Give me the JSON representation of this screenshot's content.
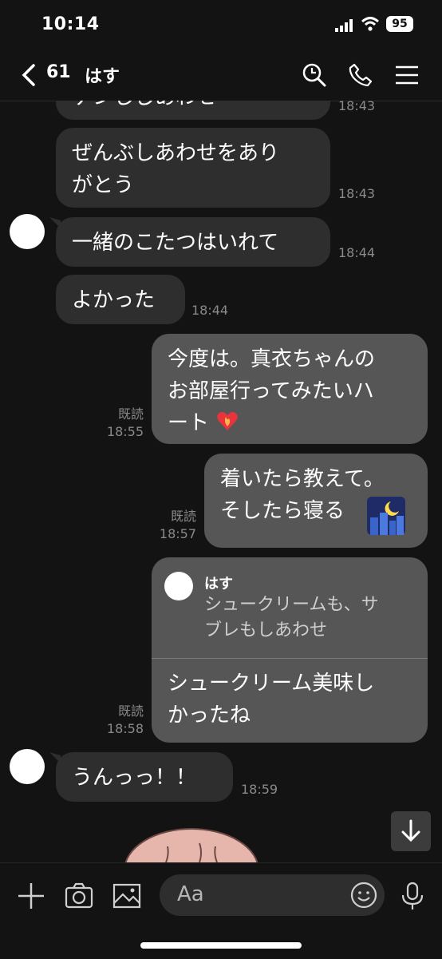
{
  "status": {
    "time": "10:14",
    "battery": "95"
  },
  "header": {
    "unread_count": "61",
    "contact_name": "はす"
  },
  "messages": [
    {
      "text": "ゲンしじあわせ",
      "time": "18:43"
    },
    {
      "text": "ぜんぶしあわせをあり\nがとう",
      "time": "18:43"
    },
    {
      "text": "一緒のこたつはいれて",
      "time": "18:44"
    },
    {
      "text": "よかった",
      "time": "18:44"
    },
    {
      "text": "今度は。真衣ちゃんの\nお部屋行ってみたいハ\nート",
      "read": "既読",
      "time": "18:55"
    },
    {
      "text": "着いたら教えて。\nそしたら寝る",
      "read": "既読",
      "time": "18:57"
    },
    {
      "reply_name": "はす",
      "reply_text": "シュークリームも、サ\nブレもしあわせ",
      "text": "シュークリーム美味し\nかったね",
      "read": "既読",
      "time": "18:58"
    },
    {
      "text": "うんっっ！！",
      "time": "18:59"
    }
  ],
  "input": {
    "placeholder": "Aa"
  },
  "icons": {
    "back": "chevron-left-icon",
    "search": "search-icon",
    "call": "phone-icon",
    "menu": "menu-icon",
    "plus": "plus-icon",
    "camera": "camera-icon",
    "image": "image-icon",
    "emoji": "emoji-icon",
    "mic": "mic-icon",
    "scroll": "arrow-down-icon"
  }
}
